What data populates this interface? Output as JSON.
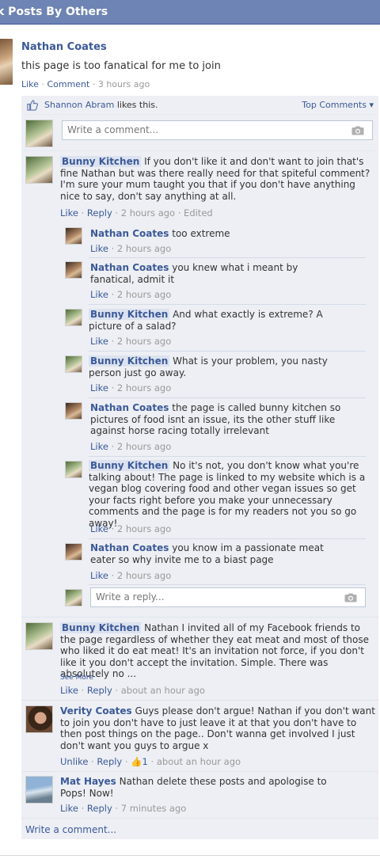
{
  "header": {
    "title": "k Posts By Others"
  },
  "post": {
    "author": "Nathan Coates",
    "text": "this page is too fanatical for me to join",
    "like": "Like",
    "comment": "Comment",
    "time": "3 hours ago"
  },
  "ufi": {
    "liker": "Shannon Abram",
    "likes_suffix": "likes this.",
    "top_comments": "Top Comments",
    "write_placeholder": "Write a comment...",
    "write_comment_link": "Write a comment..."
  },
  "comments": [
    {
      "name": "Bunny Kitchen",
      "text": "If you don't like it and don't want to join that's fine Nathan but was there really need for that spiteful comment? I'm sure your mum taught you that if you don't have anything nice to say, don't say anything at all.",
      "like": "Like",
      "reply": "Reply",
      "time": "2 hours ago",
      "edited": "Edited"
    },
    {
      "name": "Bunny Kitchen",
      "text": "Nathan I invited all of my Facebook friends to the page regardless of whether they eat meat and most of those who liked it do eat meat! It's an invitation not force, if you don't like it you don't accept the invitation. Simple. There was absolutely no ...",
      "see_more": "See More",
      "like": "Like",
      "reply": "Reply",
      "time": "about an hour ago"
    },
    {
      "name": "Verity Coates",
      "text": "Guys please don't argue! Nathan if you don't want to join you don't have to just leave it at that you don't have to then post things on the page.. Don't wanna get involved I just don't want you guys to argue x",
      "like": "Unlike",
      "reply": "Reply",
      "likes_count": "1",
      "time": "about an hour ago"
    },
    {
      "name": "Mat Hayes",
      "text": "Nathan delete these posts and apologise to Pops! Now!",
      "like": "Like",
      "reply": "Reply",
      "time": "7 minutes ago"
    }
  ],
  "replies": [
    {
      "name": "Nathan Coates",
      "text": "too extreme",
      "like": "Like",
      "time": "2 hours ago"
    },
    {
      "name": "Nathan Coates",
      "text": "you knew what i meant by fanatical, admit it",
      "like": "Like",
      "time": "2 hours ago"
    },
    {
      "name": "Bunny Kitchen",
      "text": "And what exactly is extreme? A picture of a salad?",
      "like": "Like",
      "time": "2 hours ago"
    },
    {
      "name": "Bunny Kitchen",
      "text": "What is your problem, you nasty person just go away.",
      "like": "Like",
      "time": "2 hours ago"
    },
    {
      "name": "Nathan Coates",
      "text": "the page is called bunny kitchen so pictures of food isnt an issue, its the other stuff like against horse racing totally irrelevant",
      "like": "Like",
      "time": "2 hours ago"
    },
    {
      "name": "Bunny Kitchen",
      "text": "No it's not, you don't know what you're talking about! The page is linked to my website which is a vegan blog covering food and other vegan issues so get your facts right before you make your unnecessary comments and the page is for my readers not you so go away!",
      "like": "Like",
      "time": "2 hours ago"
    },
    {
      "name": "Nathan Coates",
      "text": "you know im a passionate meat eater so why invite me to a biast page",
      "like": "Like",
      "time": "2 hours ago"
    }
  ],
  "reply_placeholder": "Write a reply...",
  "colors": {
    "header": "#6d84b4",
    "link": "#3b5998",
    "ufi_bg": "#edeff4"
  }
}
